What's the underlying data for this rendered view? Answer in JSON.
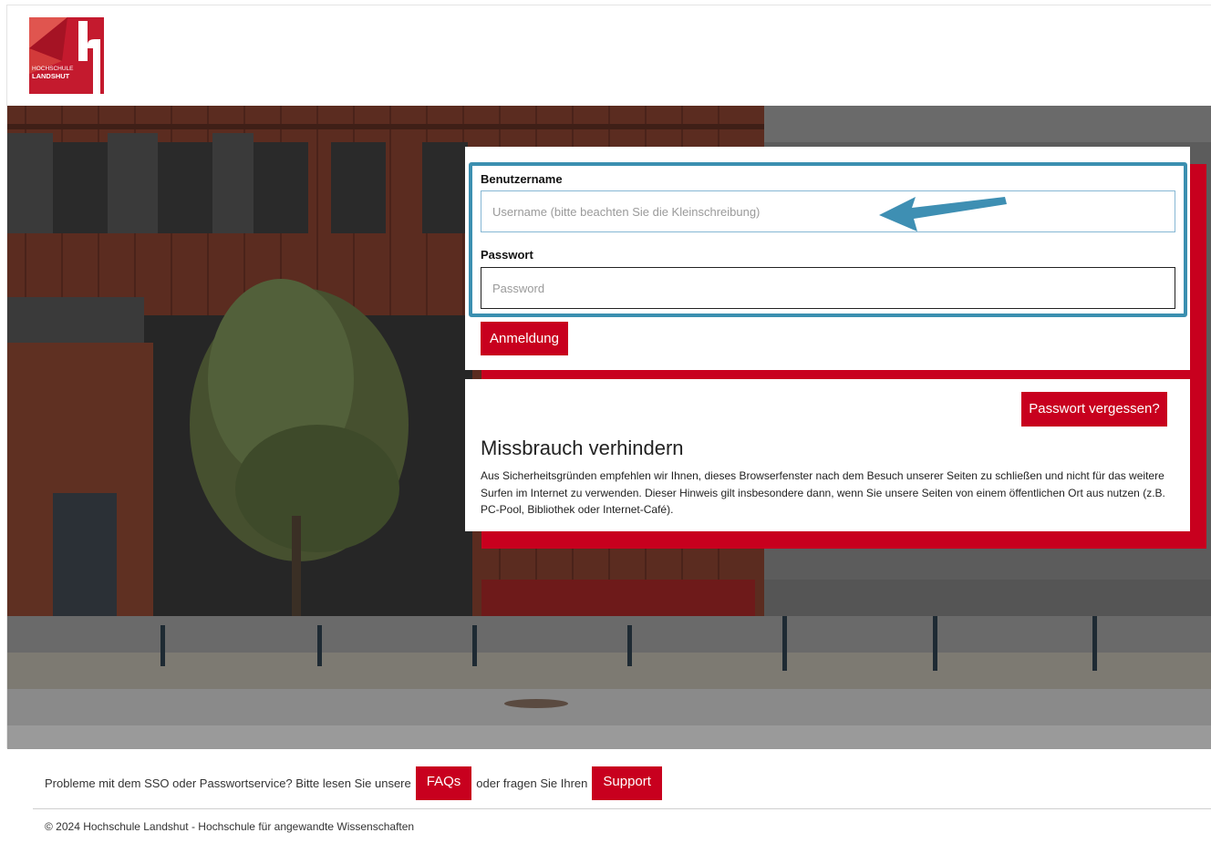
{
  "header": {
    "logo_line1": "HOCHSCHULE",
    "logo_line2": "LANDSHUT"
  },
  "login": {
    "username_label": "Benutzername",
    "username_placeholder": "Username (bitte beachten Sie die Kleinschreibung)",
    "password_label": "Passwort",
    "password_placeholder": "Password",
    "submit_label": "Anmeldung"
  },
  "info": {
    "forgot_label": "Passwort vergessen?",
    "title": "Missbrauch verhindern",
    "text": "Aus Sicherheitsgründen empfehlen wir Ihnen, dieses Browserfenster nach dem Besuch unserer Seiten zu schließen und nicht für das weitere Surfen im Internet zu verwenden. Dieser Hinweis gilt insbesondere dann, wenn Sie unsere Seiten von einem öffentlichen Ort aus nutzen (z.B. PC-Pool, Bibliothek oder Internet-Café)."
  },
  "footer": {
    "help_text_before": "Probleme mit dem SSO oder Passwortservice? Bitte lesen Sie unsere",
    "faq_label": "FAQs",
    "help_text_middle": "oder fragen Sie Ihren",
    "support_label": "Support",
    "copyright": "© 2024 Hochschule Landshut - Hochschule für angewandte Wissenschaften"
  },
  "colors": {
    "brand_red": "#c8001e",
    "highlight_blue": "#3b8fb0",
    "arrow_blue": "#3e8fb3"
  }
}
